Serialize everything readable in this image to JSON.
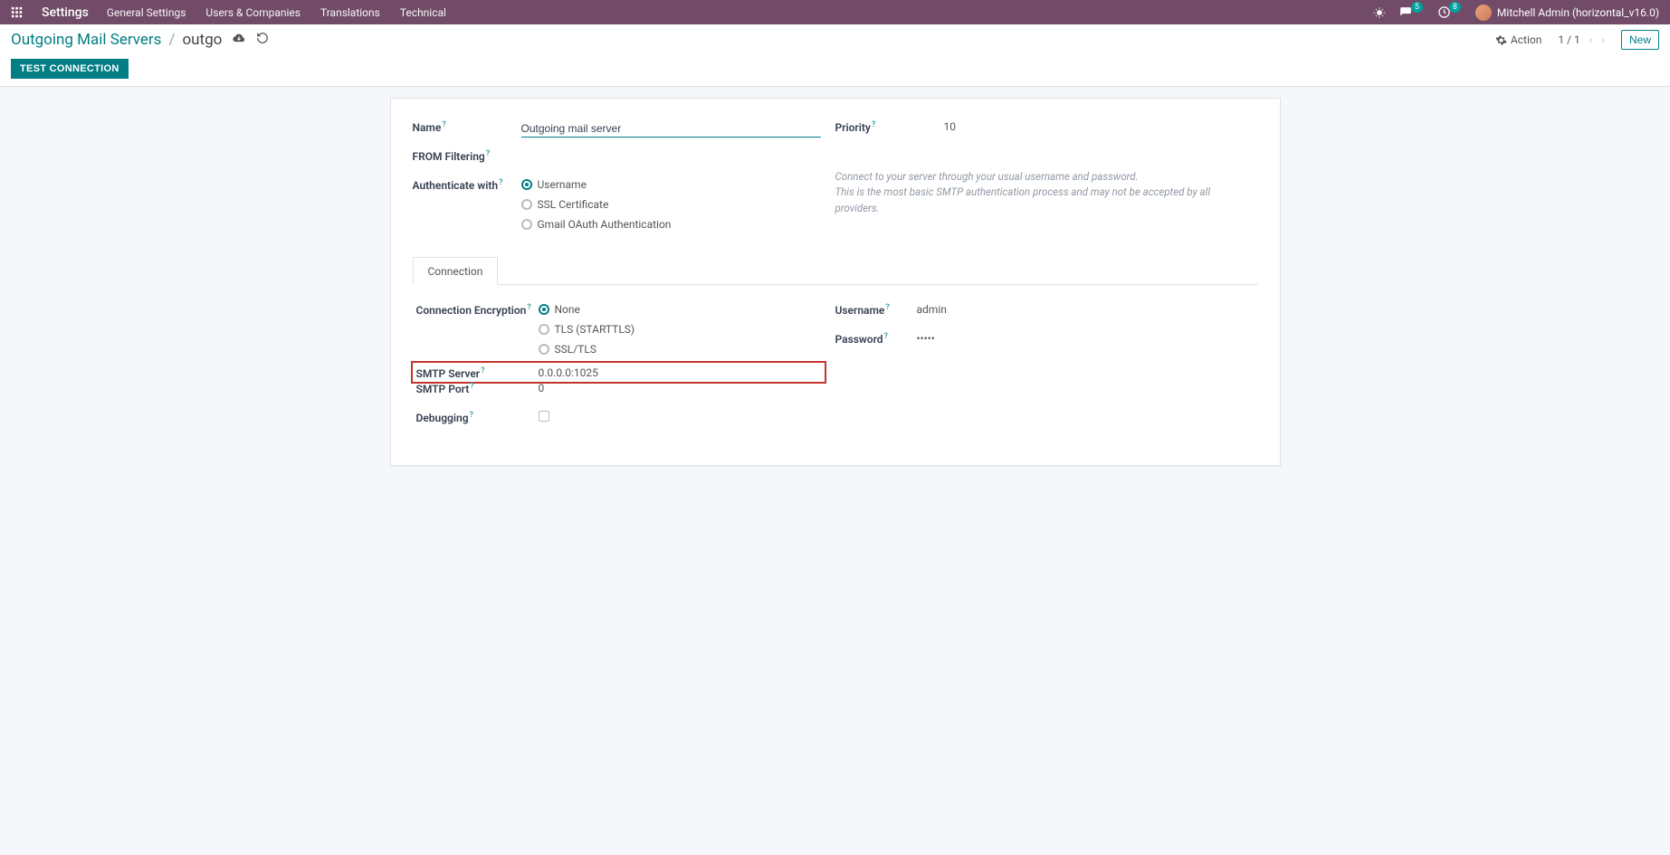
{
  "nav": {
    "app": "Settings",
    "items": [
      "General Settings",
      "Users & Companies",
      "Translations",
      "Technical"
    ],
    "msg_badge": "5",
    "clock_badge": "8",
    "user": "Mitchell Admin (horizontal_v16.0)"
  },
  "controlbar": {
    "breadcrumb_root": "Outgoing Mail Servers",
    "breadcrumb_current": "outgo",
    "action_label": "Action",
    "pager_pos": "1 / 1",
    "new_label": "New"
  },
  "buttons": {
    "test_connection": "TEST CONNECTION"
  },
  "form": {
    "name_label": "Name",
    "name_value": "Outgoing mail server",
    "from_filtering_label": "FROM Filtering",
    "authenticate_label": "Authenticate with",
    "auth_options": [
      "Username",
      "SSL Certificate",
      "Gmail OAuth Authentication"
    ],
    "auth_selected": 0,
    "priority_label": "Priority",
    "priority_value": "10",
    "auth_note_line1": "Connect to your server through your usual username and password.",
    "auth_note_line2": "This is the most basic SMTP authentication process and may not be accepted by all providers."
  },
  "tabs": {
    "connection": "Connection"
  },
  "connection": {
    "enc_label": "Connection Encryption",
    "enc_options": [
      "None",
      "TLS (STARTTLS)",
      "SSL/TLS"
    ],
    "enc_selected": 0,
    "smtp_server_label": "SMTP Server",
    "smtp_server_value": "0.0.0.0:1025",
    "smtp_port_label": "SMTP Port",
    "smtp_port_value": "0",
    "debugging_label": "Debugging",
    "username_label": "Username",
    "username_value": "admin",
    "password_label": "Password",
    "password_value": "•••••"
  }
}
